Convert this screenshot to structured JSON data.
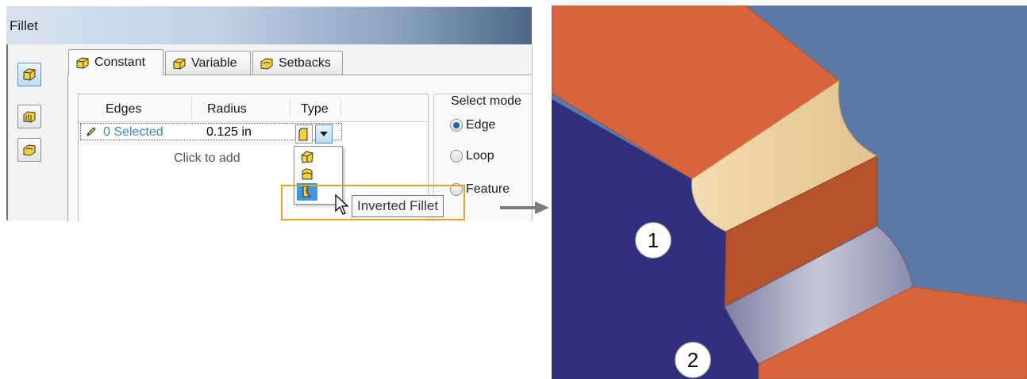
{
  "dialog": {
    "title": "Fillet",
    "tabs": [
      {
        "label": "Constant",
        "active": true
      },
      {
        "label": "Variable",
        "active": false
      },
      {
        "label": "Setbacks",
        "active": false
      }
    ],
    "grid": {
      "columns": [
        "Edges",
        "Radius",
        "Type"
      ],
      "rows": [
        {
          "edges": "0 Selected",
          "radius": "0.125 in"
        }
      ],
      "add_row_label": "Click to add"
    },
    "type_menu": {
      "items": [
        {
          "icon": "fillet-type-icon"
        },
        {
          "icon": "fillet-type-icon"
        },
        {
          "icon": "inverted-fillet-icon",
          "highlighted": true
        }
      ],
      "tooltip": "Inverted Fillet"
    },
    "select_mode": {
      "label": "Select mode",
      "options": [
        {
          "label": "Edge",
          "selected": true
        },
        {
          "label": "Loop",
          "selected": false
        },
        {
          "label": "Feature",
          "selected": false
        }
      ]
    }
  },
  "viewport": {
    "callouts": [
      "1",
      "2"
    ],
    "colors": {
      "background": "#5a7aa5",
      "top_face": "#d9643c",
      "front_face": "#2e2f7d",
      "fillet": "#eed7a8",
      "inverted_fillet": "#9ea0b8",
      "wall": "#b7522a"
    }
  }
}
